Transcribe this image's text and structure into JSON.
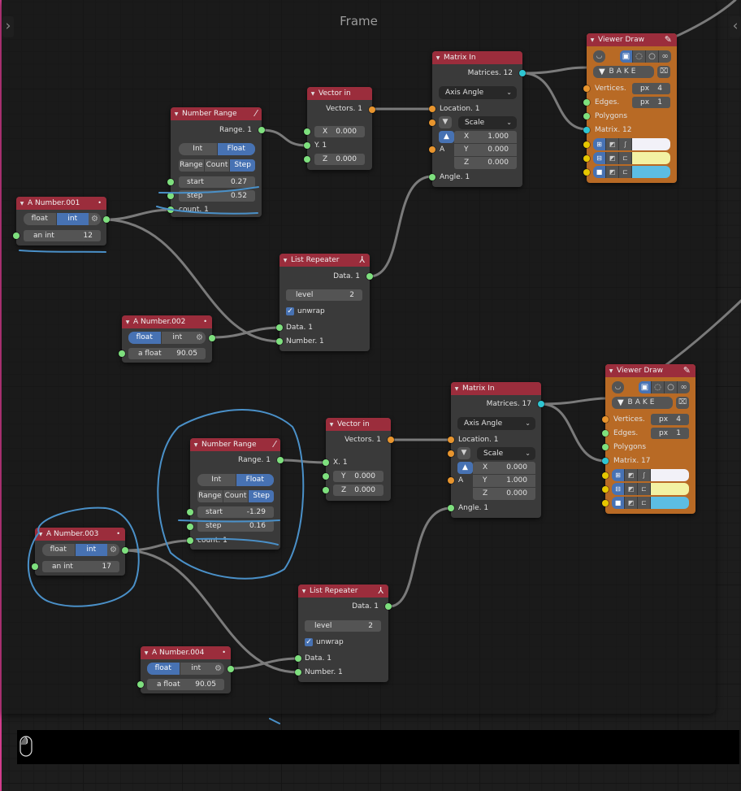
{
  "frame": {
    "label": "Frame"
  },
  "ui": {
    "left_toggle": "›",
    "right_toggle": "‹"
  },
  "group1": {
    "number_range": {
      "title": "Number Range",
      "output": "Range. 1",
      "type_options": [
        "Int",
        "Float"
      ],
      "type_selected": "Float",
      "mode_options": [
        "Range",
        "Count",
        "Step"
      ],
      "mode_selected": "Step",
      "start_label": "start",
      "start_value": "0.27",
      "step_label": "step",
      "step_value": "0.52",
      "count_label": "count. 1"
    },
    "vector_in": {
      "title": "Vector in",
      "output": "Vectors. 1",
      "x_label": "X",
      "x_value": "0.000",
      "y_label": "Y. 1",
      "z_label": "Z",
      "z_value": "0.000"
    },
    "matrix_in": {
      "title": "Matrix In",
      "output": "Matrices. 12",
      "mode": "Axis Angle",
      "location": "Location. 1",
      "scale_mode": "Scale",
      "axis_label": "A",
      "x_label": "X",
      "x_value": "1.000",
      "y_label": "Y",
      "y_value": "0.000",
      "z_label": "Z",
      "z_value": "0.000",
      "angle": "Angle. 1"
    },
    "viewer_draw": {
      "title": "Viewer Draw",
      "bake_label": "BAKE",
      "vertices_label": "Vertices.",
      "vertices_unit": "px",
      "vertices_size": "4",
      "edges_label": "Edges.",
      "edges_unit": "px",
      "edges_size": "1",
      "polygons_label": "Polygons",
      "matrix_label": "Matrix. 12",
      "colors": [
        "#f2f1f8",
        "#f3f2a3",
        "#5cbde3"
      ]
    },
    "a_number_int": {
      "title": "A Number.001",
      "type_options": [
        "float",
        "int"
      ],
      "type_selected": "int",
      "value_label": "an int",
      "value": "12"
    },
    "list_repeater": {
      "title": "List Repeater",
      "output": "Data. 1",
      "level_label": "level",
      "level_value": "2",
      "unwrap_label": "unwrap",
      "unwrap_checked": true,
      "input_data": "Data. 1",
      "input_number": "Number. 1"
    },
    "a_number_float": {
      "title": "A Number.002",
      "type_options": [
        "float",
        "int"
      ],
      "type_selected": "float",
      "value_label": "a float",
      "value": "90.05"
    }
  },
  "group2": {
    "number_range": {
      "title": "Number Range",
      "output": "Range. 1",
      "type_options": [
        "Int",
        "Float"
      ],
      "type_selected": "Float",
      "mode_options": [
        "Range",
        "Count",
        "Step"
      ],
      "mode_selected": "Step",
      "start_label": "start",
      "start_value": "-1.29",
      "step_label": "step",
      "step_value": "0.16",
      "count_label": "count. 1"
    },
    "vector_in": {
      "title": "Vector in",
      "output": "Vectors. 1",
      "x_label": "X. 1",
      "y_label": "Y",
      "y_value": "0.000",
      "z_label": "Z",
      "z_value": "0.000"
    },
    "matrix_in": {
      "title": "Matrix In",
      "output": "Matrices. 17",
      "mode": "Axis Angle",
      "location": "Location. 1",
      "scale_mode": "Scale",
      "axis_label": "A",
      "x_label": "X",
      "x_value": "0.000",
      "y_label": "Y",
      "y_value": "1.000",
      "z_label": "Z",
      "z_value": "0.000",
      "angle": "Angle. 1"
    },
    "viewer_draw": {
      "title": "Viewer Draw",
      "bake_label": "BAKE",
      "vertices_label": "Vertices.",
      "vertices_unit": "px",
      "vertices_size": "4",
      "edges_label": "Edges.",
      "edges_unit": "px",
      "edges_size": "1",
      "polygons_label": "Polygons",
      "matrix_label": "Matrix. 17",
      "colors": [
        "#f2f1f8",
        "#f3f2a3",
        "#5cbde3"
      ]
    },
    "a_number_int": {
      "title": "A Number.003",
      "type_options": [
        "float",
        "int"
      ],
      "type_selected": "int",
      "value_label": "an int",
      "value": "17"
    },
    "list_repeater": {
      "title": "List Repeater",
      "output": "Data. 1",
      "level_label": "level",
      "level_value": "2",
      "unwrap_label": "unwrap",
      "unwrap_checked": true,
      "input_data": "Data. 1",
      "input_number": "Number. 1"
    },
    "a_number_float": {
      "title": "A Number.004",
      "type_options": [
        "float",
        "int"
      ],
      "type_selected": "float",
      "value_label": "a float",
      "value": "90.05"
    }
  },
  "icons": {
    "collapse": "▼",
    "number_range": "slash-icon",
    "list_repeater": "fork-icon",
    "viewer_draw": "pencil-icon",
    "a_number": "dot-icon",
    "gear": "gears-icon",
    "status_mouse": "mouse-icon"
  },
  "colors": {
    "node_header": "#9b2d3c",
    "node_body": "#3a3a3a",
    "viewer_body": "#b86a25",
    "accent_blue": "#4772b3",
    "socket_float": "#7ee07e",
    "socket_vector": "#e8952e",
    "socket_matrix": "#2ec6d3",
    "socket_color": "#e6c700",
    "annotation": "#4a90c8"
  }
}
